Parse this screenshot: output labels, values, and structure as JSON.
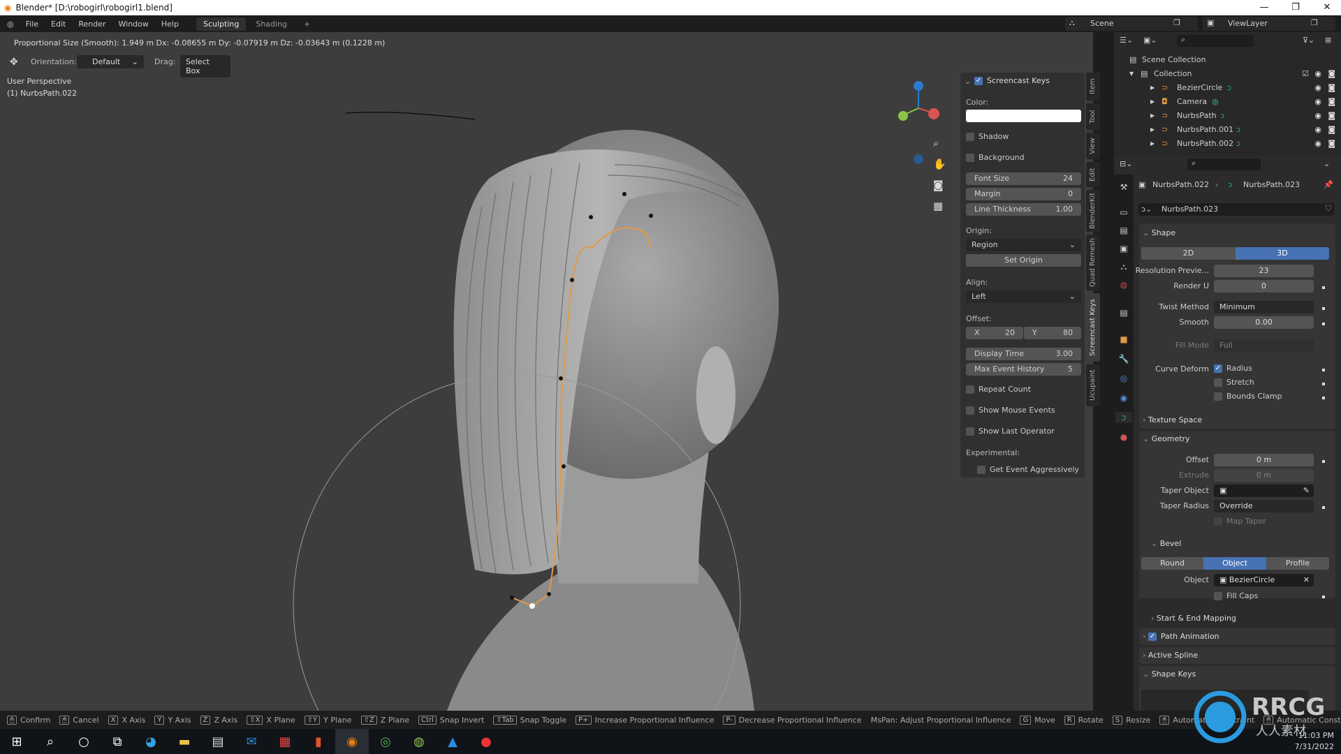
{
  "window": {
    "title": "Blender* [D:\\robogirl\\robogirl1.blend]",
    "min": "—",
    "max": "❐",
    "close": "✕"
  },
  "menu": {
    "items": [
      "File",
      "Edit",
      "Render",
      "Window",
      "Help"
    ],
    "workspaces": [
      "Sculpting",
      "Shading"
    ],
    "add": "+",
    "active_workspace": "Sculpting"
  },
  "scene": {
    "label": "Scene",
    "view_layer": "ViewLayer"
  },
  "viewport": {
    "operator_info": "Proportional Size (Smooth): 1.949 m   Dx: -0.08655 m   Dy: -0.07919 m   Dz: -0.03643 m (0.1228 m)",
    "orientation_label": "Orientation:",
    "orientation_value": "Default",
    "drag_label": "Drag:",
    "drag_value": "Select Box",
    "perspective": "User Perspective",
    "active_object": "(1) NurbsPath.022",
    "gizmo_axes": [
      "Z",
      "Y",
      "X"
    ]
  },
  "npanel": {
    "title": "Screencast Keys",
    "enabled": true,
    "color_label": "Color:",
    "color": "#ffffff",
    "shadow": "Shadow",
    "background": "Background",
    "fields": [
      {
        "label": "Font Size",
        "value": "24"
      },
      {
        "label": "Margin",
        "value": "0"
      },
      {
        "label": "Line Thickness",
        "value": "1.00"
      }
    ],
    "origin_label": "Origin:",
    "origin_value": "Region",
    "set_origin": "Set Origin",
    "align_label": "Align:",
    "align_value": "Left",
    "offset_label": "Offset:",
    "offset_x_label": "X",
    "offset_x": "20",
    "offset_y_label": "Y",
    "offset_y": "80",
    "display_time_label": "Display Time",
    "display_time": "3.00",
    "max_history_label": "Max Event History",
    "max_history": "5",
    "checks": [
      "Repeat Count",
      "Show Mouse Events",
      "Show Last Operator"
    ],
    "experimental_label": "Experimental:",
    "get_event": "Get Event Aggressively",
    "tabs": [
      "Item",
      "Tool",
      "View",
      "Edit",
      "BlenderKit",
      "Quad Remesh",
      "Screencast Keys",
      "Ucupaint"
    ],
    "active_tab": "Screencast Keys"
  },
  "outliner": {
    "root": "Scene Collection",
    "collection": "Collection",
    "items": [
      {
        "name": "BezierCircle",
        "type": "curve"
      },
      {
        "name": "Camera",
        "type": "camera"
      },
      {
        "name": "NurbsPath",
        "type": "curve"
      },
      {
        "name": "NurbsPath.001",
        "type": "curve"
      },
      {
        "name": "NurbsPath.002",
        "type": "curve"
      }
    ]
  },
  "properties": {
    "breadcrumb_object": "NurbsPath.022",
    "breadcrumb_data": "NurbsPath.023",
    "datablock": "NurbsPath.023",
    "shape": {
      "title": "Shape",
      "dim_2d": "2D",
      "dim_3d": "3D",
      "active_dim": "3D",
      "resolution_label": "Resolution Previe...",
      "resolution": "23",
      "render_u_label": "Render U",
      "render_u": "0",
      "twist_label": "Twist Method",
      "twist": "Minimum",
      "smooth_label": "Smooth",
      "smooth": "0.00",
      "fill_label": "Fill Mode",
      "fill": "Full",
      "deform_label": "Curve Deform",
      "radius": "Radius",
      "stretch": "Stretch",
      "bounds": "Bounds Clamp"
    },
    "texture_space": "Texture Space",
    "geometry": {
      "title": "Geometry",
      "offset_label": "Offset",
      "offset": "0 m",
      "extrude_label": "Extrude",
      "extrude": "0 m",
      "taper_obj_label": "Taper Object",
      "taper_radius_label": "Taper Radius",
      "taper_radius": "Override",
      "map_taper": "Map Taper"
    },
    "bevel": {
      "title": "Bevel",
      "modes": [
        "Round",
        "Object",
        "Profile"
      ],
      "active_mode": "Object",
      "object_label": "Object",
      "object": "BezierCircle",
      "fill_caps": "Fill Caps"
    },
    "start_end": "Start & End Mapping",
    "path_animation": "Path Animation",
    "active_spline": "Active Spline",
    "shape_keys": "Shape Keys"
  },
  "statusbar": [
    {
      "key": "🖱",
      "label": "Confirm"
    },
    {
      "key": "🖱",
      "label": "Cancel"
    },
    {
      "key": "X",
      "label": "X Axis"
    },
    {
      "key": "Y",
      "label": "Y Axis"
    },
    {
      "key": "Z",
      "label": "Z Axis"
    },
    {
      "key": "⇧X",
      "label": "X Plane"
    },
    {
      "key": "⇧Y",
      "label": "Y Plane"
    },
    {
      "key": "⇧Z",
      "label": "Z Plane"
    },
    {
      "key": "Ctrl",
      "label": "Snap Invert"
    },
    {
      "key": "⇧Tab",
      "label": "Snap Toggle"
    },
    {
      "key": "P+",
      "label": "Increase Proportional Influence"
    },
    {
      "key": "P-",
      "label": "Decrease Proportional Influence"
    },
    {
      "key": "",
      "label": "MsPan: Adjust Proportional Influence"
    },
    {
      "key": "G",
      "label": "Move"
    },
    {
      "key": "R",
      "label": "Rotate"
    },
    {
      "key": "S",
      "label": "Resize"
    },
    {
      "key": "🖱",
      "label": "Automatic Constraint"
    },
    {
      "key": "🖱",
      "label": "Automatic Constraint Plane"
    }
  ],
  "taskbar": {
    "icons": [
      "windows-start",
      "search",
      "cortana",
      "task-view",
      "edge",
      "file-explorer",
      "store",
      "mail",
      "app",
      "office",
      "blender",
      "chrome",
      "app-green",
      "photos",
      "recorder"
    ],
    "active": "blender",
    "time": "11:03 PM",
    "date": "7/31/2022"
  },
  "watermark": {
    "text": "RRCG",
    "subtext": "人人素材"
  },
  "colors": {
    "accent": "#4772b3",
    "curve": "#e29a4a",
    "selection": "#e8933a"
  }
}
